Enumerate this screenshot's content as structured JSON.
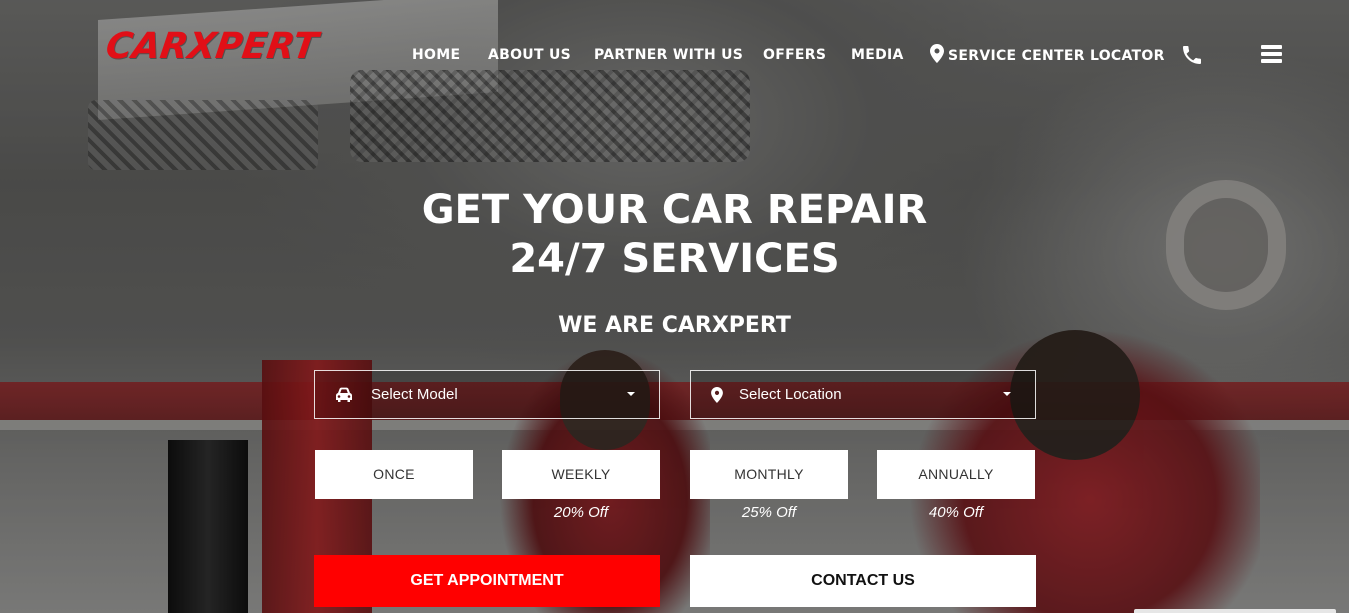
{
  "brand": {
    "logo_text": "CARXPERT",
    "accent": "#e10f17"
  },
  "nav": {
    "items": [
      {
        "label": "HOME"
      },
      {
        "label": "ABOUT US"
      },
      {
        "label": "PARTNER WITH US"
      },
      {
        "label": "OFFERS"
      },
      {
        "label": "MEDIA"
      },
      {
        "label": "SERVICE CENTER LOCATOR",
        "icon": "map-pin-icon"
      }
    ],
    "phone_icon": "phone-icon",
    "menu_icon": "hamburger-menu-icon"
  },
  "hero": {
    "headline_line1": "GET YOUR CAR REPAIR",
    "headline_line2": "24/7 SERVICES",
    "subheading": "WE ARE CARXPERT"
  },
  "form": {
    "model_select": {
      "value": "Select Model",
      "icon": "car-icon"
    },
    "location_select": {
      "value": "Select Location",
      "icon": "map-pin-icon"
    }
  },
  "plans": [
    {
      "label": "ONCE",
      "discount": ""
    },
    {
      "label": "WEEKLY",
      "discount": "20% Off"
    },
    {
      "label": "MONTHLY",
      "discount": "25% Off"
    },
    {
      "label": "ANNUALLY",
      "discount": "40% Off"
    }
  ],
  "cta": {
    "primary_label": "GET APPOINTMENT",
    "secondary_label": "CONTACT US",
    "primary_color": "#ff0000"
  }
}
